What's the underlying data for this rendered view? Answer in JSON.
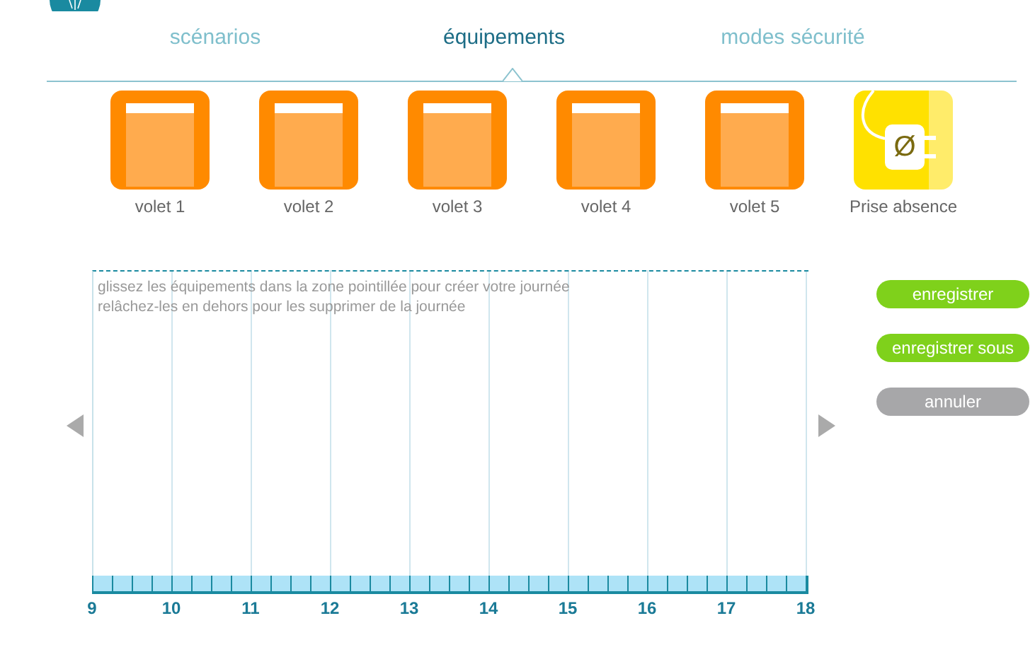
{
  "tabs": [
    {
      "label": "scénarios",
      "selected": false
    },
    {
      "label": "équipements",
      "selected": true
    },
    {
      "label": "modes sécurité",
      "selected": false
    }
  ],
  "devices": [
    {
      "kind": "volet",
      "label": "volet 1"
    },
    {
      "kind": "volet",
      "label": "volet 2"
    },
    {
      "kind": "volet",
      "label": "volet 3"
    },
    {
      "kind": "volet",
      "label": "volet 4"
    },
    {
      "kind": "volet",
      "label": "volet 5"
    },
    {
      "kind": "prise",
      "label": "Prise absence",
      "symbol": "Ø"
    }
  ],
  "timeline": {
    "hint": [
      "glissez les équipements dans la zone pointillée pour créer votre journée",
      "relâchez-les en dehors pour les supprimer de la journée"
    ],
    "hours": [
      "9",
      "10",
      "11",
      "12",
      "13",
      "14",
      "15",
      "16",
      "17",
      "18"
    ]
  },
  "buttons": [
    {
      "label": "enregistrer",
      "kind": "primary"
    },
    {
      "label": "enregistrer sous",
      "kind": "primary"
    },
    {
      "label": "annuler",
      "kind": "secondary"
    }
  ]
}
